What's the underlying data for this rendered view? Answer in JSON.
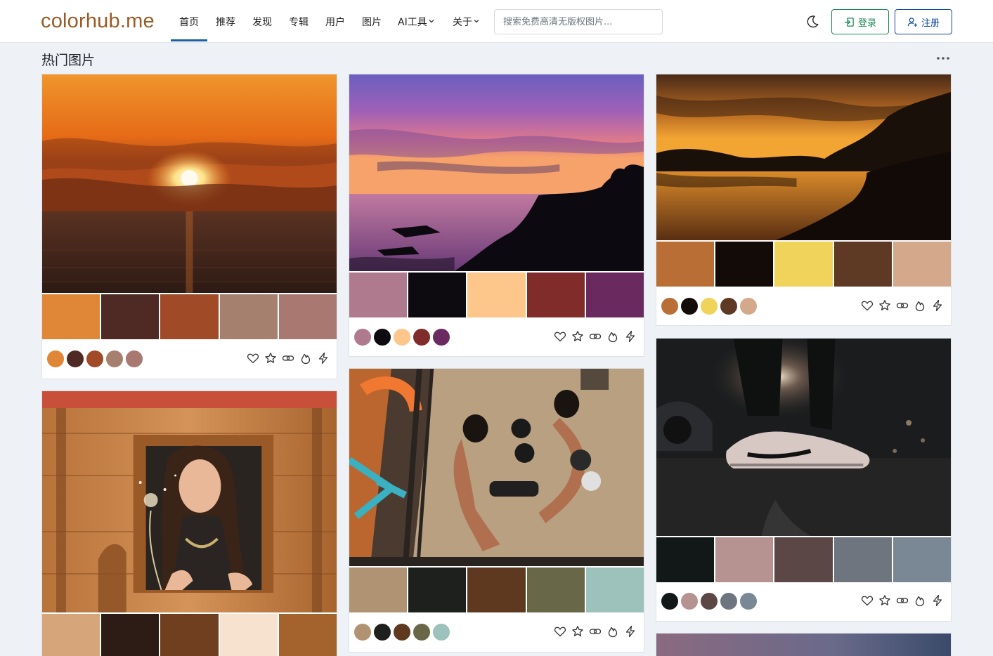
{
  "app": {
    "logo": "colorhub.me",
    "nav": [
      {
        "label": "首页",
        "active": true
      },
      {
        "label": "推荐"
      },
      {
        "label": "发现"
      },
      {
        "label": "专辑"
      },
      {
        "label": "用户"
      },
      {
        "label": "图片"
      },
      {
        "label": "AI工具",
        "dropdown": true
      },
      {
        "label": "关于",
        "dropdown": true
      }
    ],
    "search": {
      "placeholder": "搜索免费高清无版权图片...",
      "value": ""
    },
    "theme_icon": "moon-icon",
    "login": {
      "label": "登录",
      "icon": "login-icon"
    },
    "register": {
      "label": "注册",
      "icon": "person-add-icon"
    }
  },
  "section": {
    "title": "热门图片",
    "more_icon": "more-dots-icon"
  },
  "action_icons": [
    "heart-icon",
    "star-icon",
    "link-icon",
    "fire-icon",
    "bolt-icon"
  ],
  "cards": [
    {
      "subject": "sunset-over-sea",
      "palette": [
        "#e08637",
        "#4f2a24",
        "#a04a28",
        "#a5806f",
        "#a87871"
      ]
    },
    {
      "subject": "purple-sunset-shore",
      "palette": [
        "#b07a8e",
        "#0e0b10",
        "#fdc78c",
        "#7f2c2a",
        "#6a2a60"
      ]
    },
    {
      "subject": "golden-lake-mountains",
      "palette": [
        "#b96e36",
        "#120b08",
        "#f0d35b",
        "#5e3a24",
        "#d4a88a"
      ]
    },
    {
      "subject": "woman-blowing-dandelion",
      "palette": [
        "#d7a57a",
        "#2d1b15",
        "#6f3f1f",
        "#f6e2ce",
        "#a4622c"
      ]
    },
    {
      "subject": "boxing-match-aerial",
      "palette": [
        "#af9373",
        "#1e201d",
        "#5f3820",
        "#686848",
        "#9cc2bb"
      ]
    },
    {
      "subject": "sneakers-night-street",
      "palette": [
        "#121817",
        "#b69391",
        "#5c4747",
        "#6f757f",
        "#7a8896"
      ]
    },
    {
      "subject": "dusk-sky-partial",
      "palette": []
    }
  ]
}
